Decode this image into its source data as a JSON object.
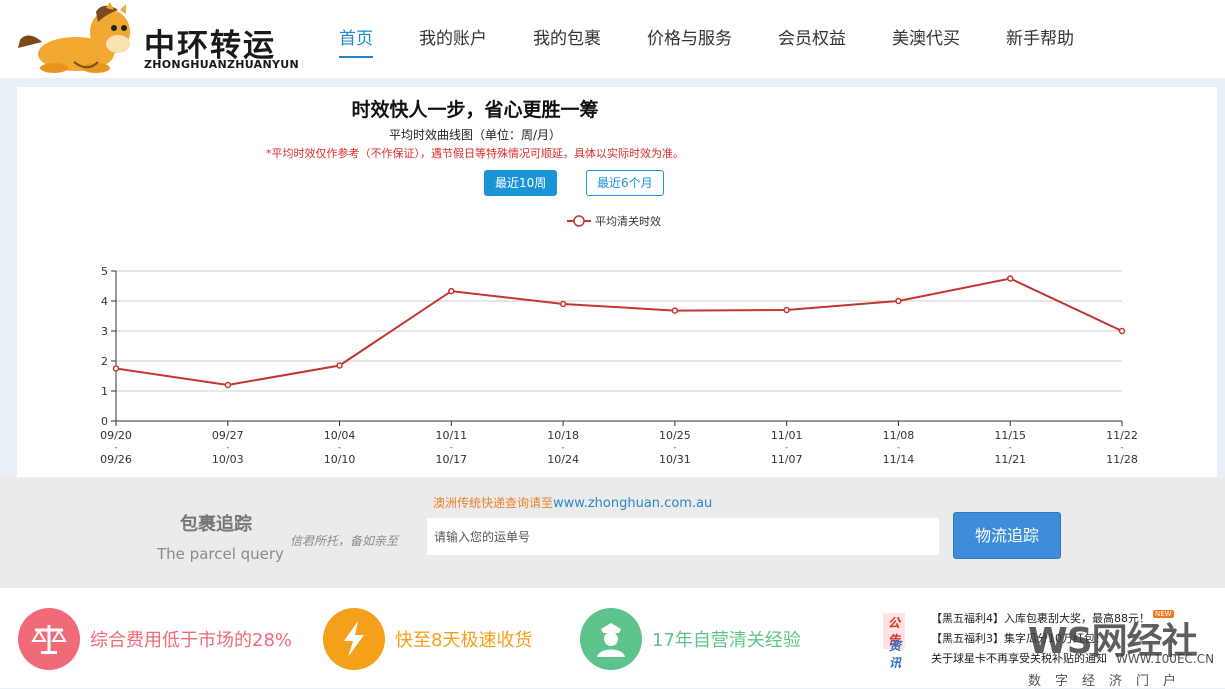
{
  "header": {
    "logo_text": "中环转运",
    "logo_sub": "ZHONGHUANZHUANYUN",
    "nav": [
      "首页",
      "我的账户",
      "我的包裹",
      "价格与服务",
      "会员权益",
      "美澳代买",
      "新手帮助"
    ],
    "active_index": 0
  },
  "panel": {
    "headline": "时效快人一步，省心更胜一筹",
    "subtitle": "平均时效曲线图（单位：周/月）",
    "note": "*平均时效仅作参考（不作保证），遇节假日等特殊情况可顺延，具体以实际时效为准。",
    "tabs": [
      "最近10周",
      "最近6个月"
    ],
    "active_tab": 0
  },
  "chart_data": {
    "type": "line",
    "legend": "平均清关时效",
    "legend_position": "top-center",
    "categories_top": [
      "09/20",
      "09/27",
      "10/04",
      "10/11",
      "10/18",
      "10/25",
      "11/01",
      "11/08",
      "11/15",
      "11/22"
    ],
    "categories_bottom": [
      "09/26",
      "10/03",
      "10/10",
      "10/17",
      "10/24",
      "10/31",
      "11/07",
      "11/14",
      "11/21",
      "11/28"
    ],
    "series": [
      {
        "name": "平均清关时效",
        "values": [
          1.75,
          1.2,
          1.85,
          4.33,
          3.9,
          3.68,
          3.7,
          4.0,
          4.75,
          3.0
        ],
        "color": "#c23531"
      }
    ],
    "ylim": [
      0,
      5
    ],
    "yticks": [
      0,
      1,
      2,
      3,
      4,
      5
    ],
    "grid": true
  },
  "tracking": {
    "title": "包裹追踪",
    "subtitle": "The parcel query",
    "slogan": "信君所托，备如亲至",
    "notice": "澳洲传统快递查询请至",
    "notice_link": "www.zhonghuan.com.au",
    "placeholder": "请输入您的运单号",
    "button": "物流追踪"
  },
  "features": [
    {
      "text": "综合费用低于市场的28%",
      "icon": "scale-icon",
      "color": "#f06a78"
    },
    {
      "text": "快至8天极速收货",
      "icon": "lightning-icon",
      "color": "#f5a01a"
    },
    {
      "text": "17年自营清关经验",
      "icon": "officer-icon",
      "color": "#5cc48a"
    }
  ],
  "news": {
    "announce_tag": "公告",
    "info_tag": "资讯",
    "items": [
      "【黑五福利4】入库包裹刮大奖，最高88元！",
      "【黑五福利3】集字瓜分10万红包！",
      "关于球星卡不再享受关税补贴的通知"
    ],
    "new_badge": "NEW"
  },
  "watermark": {
    "brand": "WS网经社",
    "url": "WWW.100EC.CN",
    "tagline": "数字经济门户"
  }
}
